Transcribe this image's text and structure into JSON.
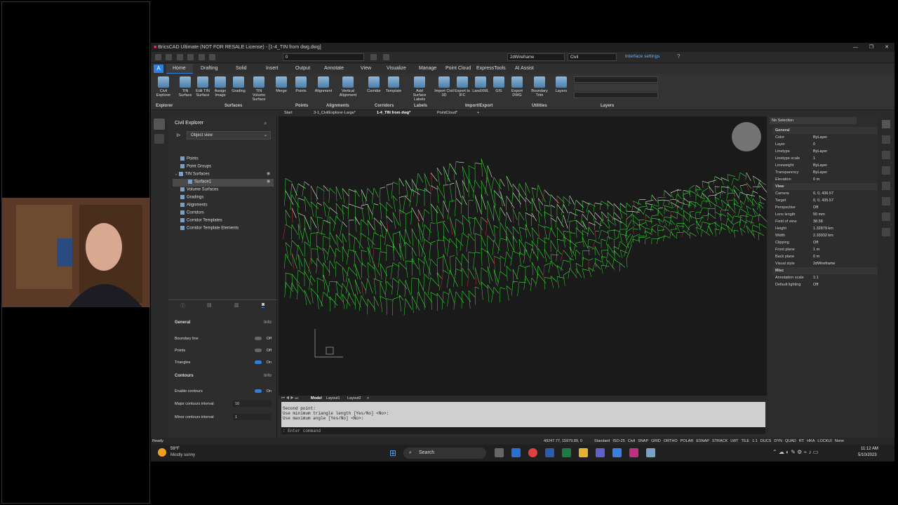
{
  "app": {
    "title": "BricsCAD Ultimate (NOT FOR RESALE License) - [1-4_TIN from dwg.dwg]",
    "layer_combo": "0",
    "visual_style_combo": "2dWireframe",
    "workspace_combo": "Civil",
    "interface_settings": "Interface settings"
  },
  "tabs": [
    "Home",
    "Drafting",
    "Solid",
    "Insert",
    "Output",
    "Annotate",
    "View",
    "Visualize",
    "Manage",
    "Point Cloud",
    "ExpressTools",
    "AI Assist"
  ],
  "ribbon": {
    "tools": [
      {
        "label": "Civil Explorer"
      },
      {
        "label": "TIN Surface"
      },
      {
        "label": "Edit TIN Surface"
      },
      {
        "label": "Assign Image"
      },
      {
        "label": "Grading"
      },
      {
        "label": "TIN Volume Surface"
      },
      {
        "label": "Merge"
      },
      {
        "label": "Points"
      },
      {
        "label": "Alignment"
      },
      {
        "label": "Vertical Alignment"
      },
      {
        "label": "Corridor"
      },
      {
        "label": "Template"
      },
      {
        "label": "Add Surface Labels"
      },
      {
        "label": "Import Civil 3D"
      },
      {
        "label": "Export to IFC"
      },
      {
        "label": "LandXML"
      },
      {
        "label": "GIS"
      },
      {
        "label": "Export DWG"
      },
      {
        "label": "Boundary Trim"
      },
      {
        "label": "Layers"
      }
    ],
    "groups": [
      "Explorer",
      "Surfaces",
      "Points",
      "Alignments",
      "Corridors",
      "Labels",
      "Import/Export",
      "Utilities",
      "Layers"
    ]
  },
  "doc_tabs": [
    "Start",
    "3-1_CivilExplorer-Large*",
    "1-4_TIN from dwg*",
    "PointCloud*"
  ],
  "explorer": {
    "title": "Civil Explorer",
    "view_select": "Object view",
    "tree": [
      "Points",
      "Point Groups",
      "TIN Surfaces",
      "Surface1",
      "Volume Surfaces",
      "Gradings",
      "Alignments",
      "Corridors",
      "Corridor Templates",
      "Corridor Template Elements"
    ],
    "general_label": "General",
    "info": "Info",
    "boundary_line": {
      "label": "Boundary line",
      "value": "Off"
    },
    "points": {
      "label": "Points",
      "value": "Off"
    },
    "triangles": {
      "label": "Triangles",
      "value": "On"
    },
    "contours_label": "Contours",
    "enable_contours": {
      "label": "Enable contours",
      "value": "On"
    },
    "major_interval": {
      "label": "Major contours interval",
      "value": "10"
    },
    "minor_interval": {
      "label": "Minor contours interval",
      "value": "1"
    }
  },
  "layout_tabs": [
    "Model",
    "Layout1",
    "Layout2"
  ],
  "command": {
    "lines": [
      "Second point:",
      "Use minimum triangle length [Yes/No] <No>:",
      "Use maximum angle [Yes/No] <No>:"
    ],
    "placeholder": ": Enter command"
  },
  "properties": {
    "selection": "No Selection",
    "rows": [
      {
        "k": "General",
        "v": "",
        "hdr": true
      },
      {
        "k": "Color",
        "v": "ByLayer"
      },
      {
        "k": "Layer",
        "v": "0"
      },
      {
        "k": "Linetype",
        "v": "ByLayer"
      },
      {
        "k": "Linetype scale",
        "v": "1"
      },
      {
        "k": "Lineweight",
        "v": "ByLayer"
      },
      {
        "k": "Transparency",
        "v": "ByLayer"
      },
      {
        "k": "Elevation",
        "v": "0 m"
      },
      {
        "k": "View",
        "v": "",
        "hdr": true
      },
      {
        "k": "Camera",
        "v": "0, 0, 436.57"
      },
      {
        "k": "Target",
        "v": "0, 0, 435.57"
      },
      {
        "k": "Perspective",
        "v": "Off"
      },
      {
        "k": "Lens length",
        "v": "50 mm"
      },
      {
        "k": "Field of view",
        "v": "38.58"
      },
      {
        "k": "Height",
        "v": "1.32879 km"
      },
      {
        "k": "Width",
        "v": "2.33932 km"
      },
      {
        "k": "Clipping",
        "v": "Off"
      },
      {
        "k": "Front plane",
        "v": "1 m"
      },
      {
        "k": "Back plane",
        "v": "0 m"
      },
      {
        "k": "Visual style",
        "v": "2dWireframe"
      },
      {
        "k": "Misc",
        "v": "",
        "hdr": true
      },
      {
        "k": "Annotation scale",
        "v": "1:1"
      },
      {
        "k": "Default lighting",
        "v": "Off"
      }
    ]
  },
  "status": {
    "ready": "Ready",
    "coords": "49247.77, 15979.89, 0",
    "items": [
      "Standard",
      "ISO-25",
      "Civil",
      "SNAP",
      "GRID",
      "ORTHO",
      "POLAR",
      "ESNAP",
      "STRACK",
      "LWT",
      "TILE",
      "1:1",
      "DUCS",
      "DYN",
      "QUAD",
      "RT",
      "HKA",
      "LOCKUI",
      "None"
    ]
  },
  "taskbar": {
    "weather_temp": "59°F",
    "weather_desc": "Mostly sunny",
    "search": "Search",
    "time": "11:12 AM",
    "date": "5/10/2023"
  },
  "colors": {
    "accent": "#2f7fe0",
    "mesh": "#35e035",
    "mesh_light": "#e8f8e0",
    "contour_red": "#d03040"
  }
}
